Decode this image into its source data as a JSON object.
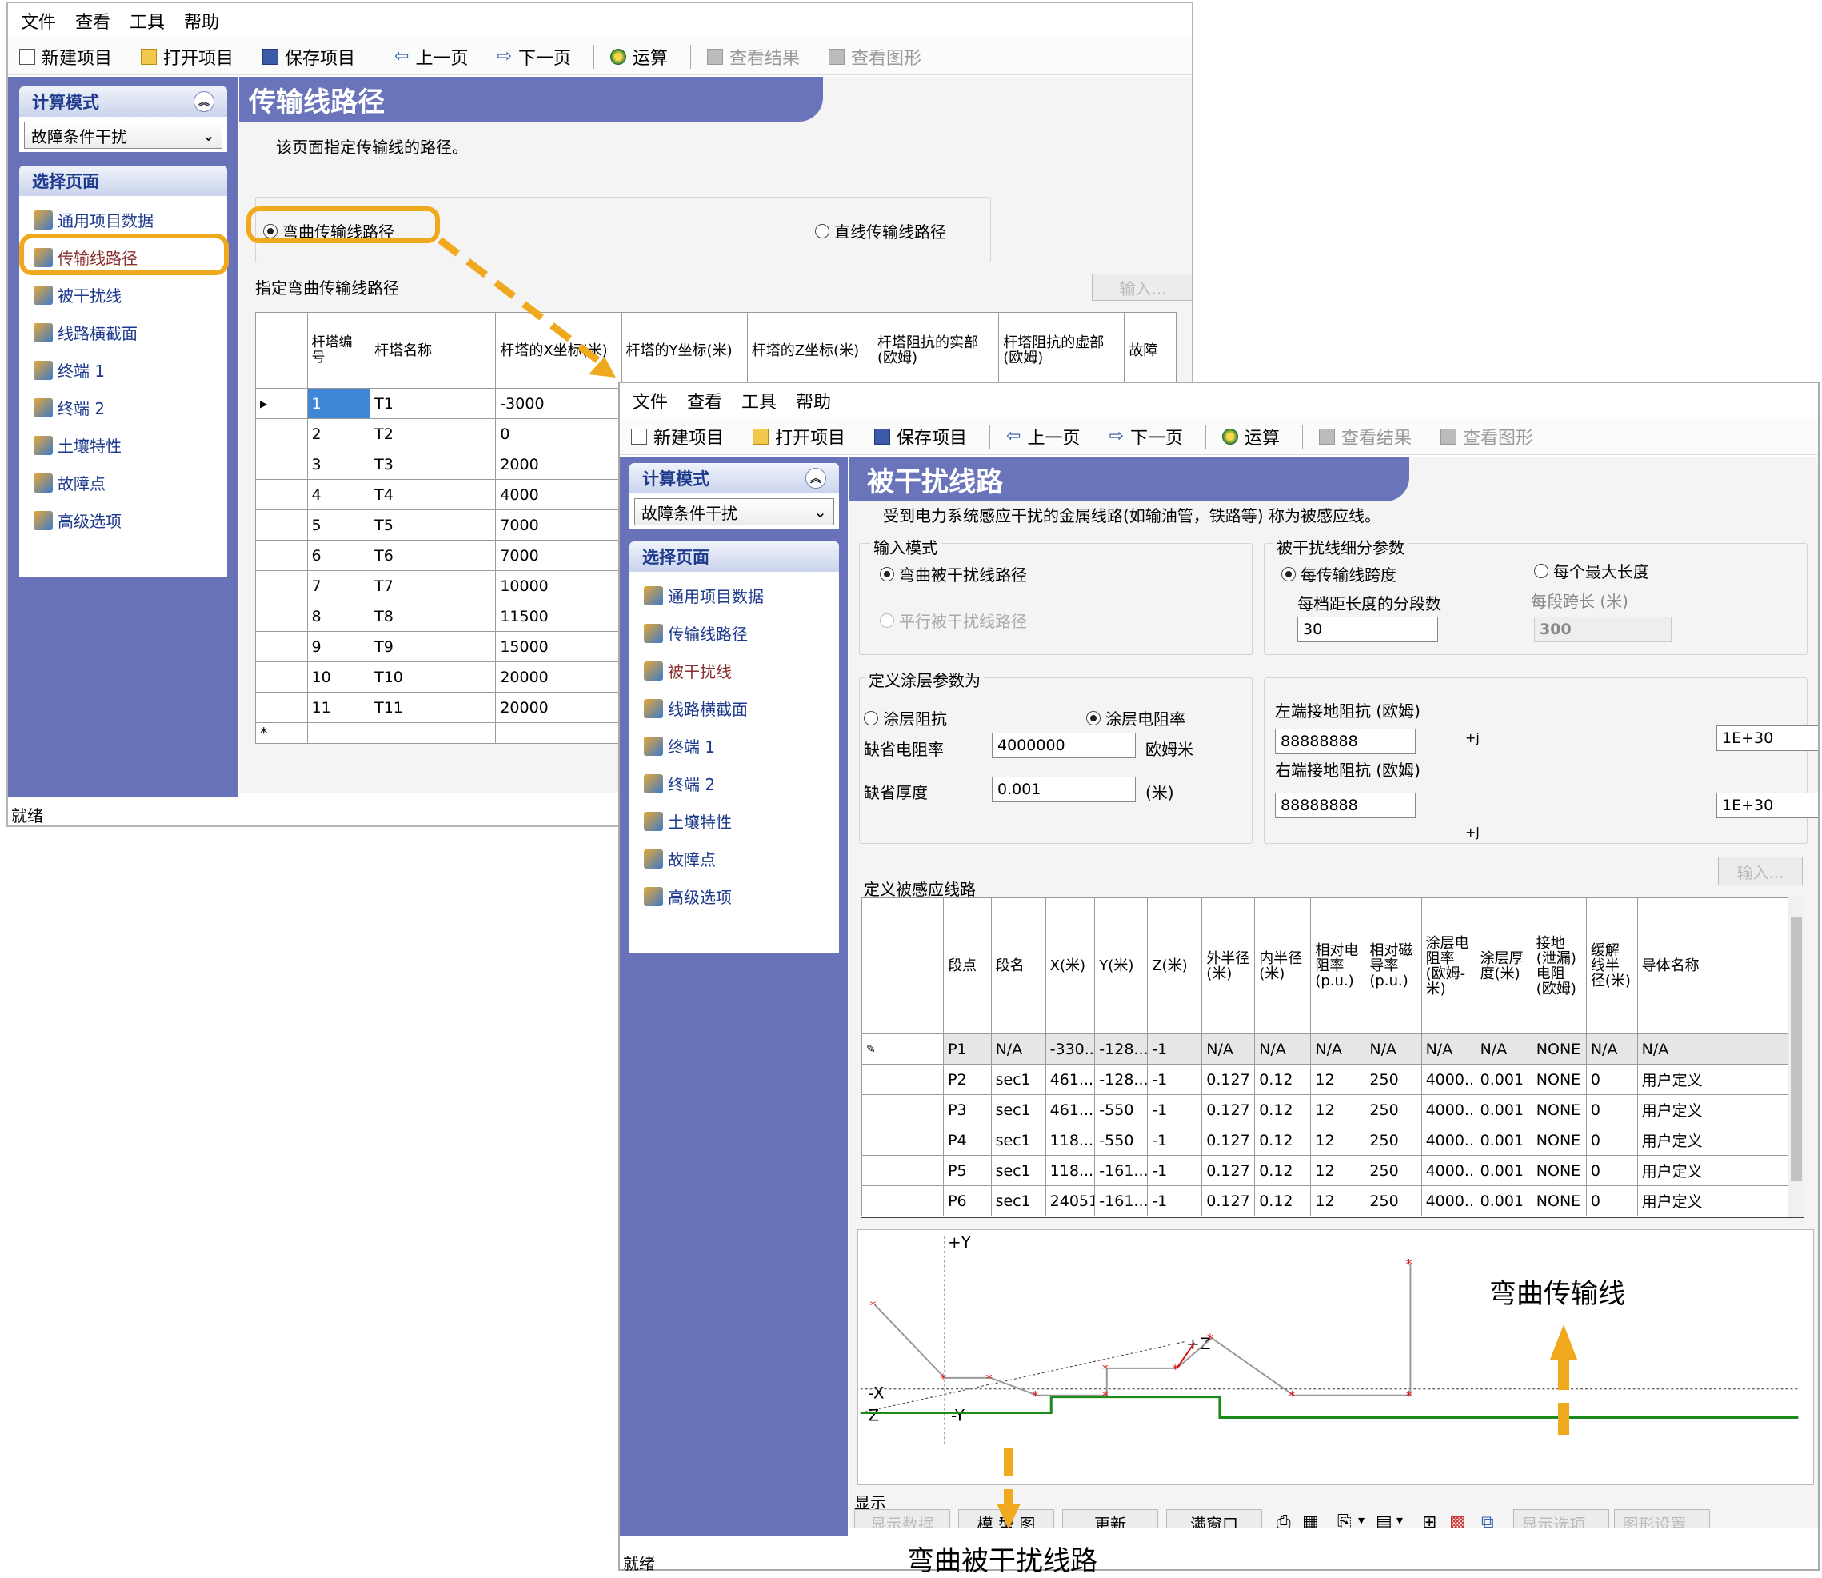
{
  "menu": [
    "文件",
    "查看",
    "工具",
    "帮助"
  ],
  "toolbar": {
    "new": "新建项目",
    "open": "打开项目",
    "save": "保存项目",
    "prev": "上一页",
    "next": "下一页",
    "run": "运算",
    "results": "查看结果",
    "graph": "查看图形"
  },
  "sidebar": {
    "mode_title": "计算模式",
    "mode_value": "故障条件干扰",
    "pages_title": "选择页面",
    "items": [
      "通用项目数据",
      "传输线路径",
      "被干扰线",
      "线路横截面",
      "终端 1",
      "终端 2",
      "土壤特性",
      "故障点",
      "高级选项"
    ]
  },
  "win1": {
    "title": "传输线路径",
    "desc": "该页面指定传输线的路径。",
    "radio_curved": "弯曲传输线路径",
    "radio_straight": "直线传输线路径",
    "section": "指定弯曲传输线路径",
    "input_btn": "输入...",
    "status": "就绪",
    "columns": [
      "杆塔编号",
      "杆塔名称",
      "杆塔的X坐标(米)",
      "杆塔的Y坐标(米)",
      "杆塔的Z坐标(米)",
      "杆塔阻抗的实部(欧姆)",
      "杆塔阻抗的虚部(欧姆)",
      "故障"
    ],
    "rows": [
      [
        "1",
        "T1",
        "-3000"
      ],
      [
        "2",
        "T2",
        "0"
      ],
      [
        "3",
        "T3",
        "2000"
      ],
      [
        "4",
        "T4",
        "4000"
      ],
      [
        "5",
        "T5",
        "7000"
      ],
      [
        "6",
        "T6",
        "7000"
      ],
      [
        "7",
        "T7",
        "10000"
      ],
      [
        "8",
        "T8",
        "11500"
      ],
      [
        "9",
        "T9",
        "15000"
      ],
      [
        "10",
        "T10",
        "20000"
      ],
      [
        "11",
        "T11",
        "20000"
      ]
    ]
  },
  "win2": {
    "title": "被干扰线路",
    "desc": "受到电力系统感应干扰的金属线路(如输油管，铁路等) 称为被感应线。",
    "input_mode": "输入模式",
    "radio_curved": "弯曲被干扰线路径",
    "radio_parallel": "平行被干扰线路径",
    "subdiv": "被干扰线细分参数",
    "radio_per_span": "每传输线跨度",
    "radio_max_len": "每个最大长度",
    "seg_per_span": "每档距长度的分段数",
    "seg_per_span_val": "30",
    "span_len": "每段跨长 (米)",
    "span_len_val": "300",
    "coating": "定义涂层参数为",
    "radio_imp": "涂层阻抗",
    "radio_res": "涂层电阻率",
    "def_res": "缺省电阻率",
    "def_res_val": "4000000",
    "def_res_unit": "欧姆米",
    "def_thk": "缺省厚度",
    "def_thk_val": "0.001",
    "def_thk_unit": "(米)",
    "left_gnd": "左端接地阻抗 (欧姆)",
    "left_re": "88888888",
    "left_im": "1E+30",
    "right_gnd": "右端接地阻抗 (欧姆)",
    "right_re": "88888888",
    "right_im": "1E+30",
    "j": "+j",
    "input_btn": "输入...",
    "define_lines": "定义被感应线路",
    "columns": [
      "段点",
      "段名",
      "X(米)",
      "Y(米)",
      "Z(米)",
      "外半径(米)",
      "内半径(米)",
      "相对电阻率(p.u.)",
      "相对磁导率(p.u.)",
      "涂层电阻率(欧姆-米)",
      "涂层厚度(米)",
      "接地(泄漏)电阻(欧姆)",
      "缓解线半径(米)",
      "导体名称"
    ],
    "rows": [
      [
        "P1",
        "N/A",
        "-330...",
        "-128...",
        "-1",
        "N/A",
        "N/A",
        "N/A",
        "N/A",
        "N/A",
        "N/A",
        "NONE",
        "N/A",
        "N/A"
      ],
      [
        "P2",
        "sec1",
        "461...",
        "-128...",
        "-1",
        "0.127",
        "0.12",
        "12",
        "250",
        "4000...",
        "0.001",
        "NONE",
        "0",
        "用户定义"
      ],
      [
        "P3",
        "sec1",
        "461...",
        "-550",
        "-1",
        "0.127",
        "0.12",
        "12",
        "250",
        "4000...",
        "0.001",
        "NONE",
        "0",
        "用户定义"
      ],
      [
        "P4",
        "sec1",
        "118...",
        "-550",
        "-1",
        "0.127",
        "0.12",
        "12",
        "250",
        "4000...",
        "0.001",
        "NONE",
        "0",
        "用户定义"
      ],
      [
        "P5",
        "sec1",
        "118...",
        "-161...",
        "-1",
        "0.127",
        "0.12",
        "12",
        "250",
        "4000...",
        "0.001",
        "NONE",
        "0",
        "用户定义"
      ],
      [
        "P6",
        "sec1",
        "24051",
        "-161...",
        "-1",
        "0.127",
        "0.12",
        "12",
        "250",
        "4000...",
        "0.001",
        "NONE",
        "0",
        "用户定义"
      ]
    ],
    "plot_labels": {
      "py": "+Y",
      "nx": "-X",
      "ny": "-Y",
      "z": "Z",
      "pz": "+Z"
    },
    "display": "显示",
    "btn_show_data": "显示数据",
    "btn_model": "模 型 图",
    "btn_update": "更新",
    "btn_full": "满窗口",
    "btn_show_opt": "显示选项...",
    "btn_graph_set": "图形设置...",
    "status": "就绪"
  },
  "annotations": {
    "curved_tl": "弯曲传输线",
    "curved_dl": "弯曲被干扰线路"
  },
  "colors": {
    "accent": "#f0a81d",
    "sidebar": "#6872b8",
    "title": "#6a74bb",
    "green": "#1a8a1a"
  }
}
